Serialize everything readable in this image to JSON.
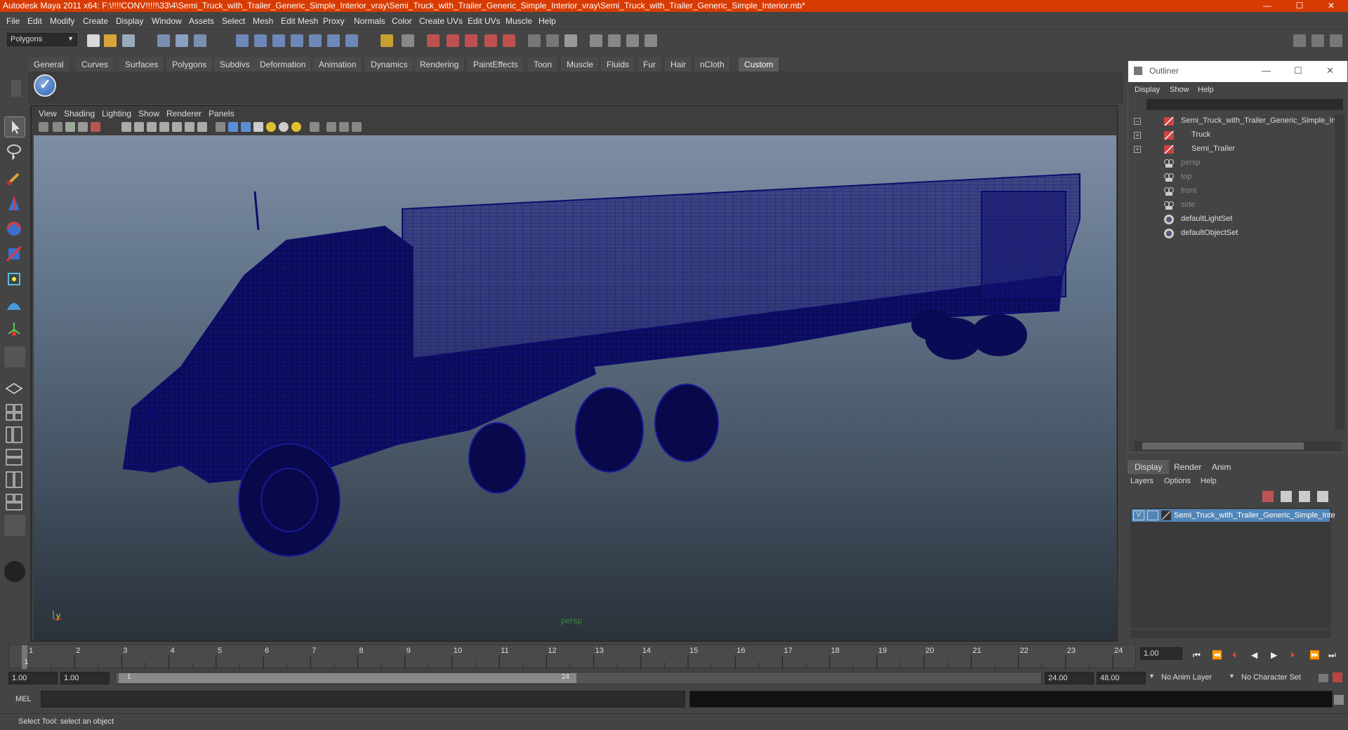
{
  "window": {
    "title": "Autodesk Maya 2011 x64: F:\\!!!!CONV!!!!!\\33\\4\\Semi_Truck_with_Trailer_Generic_Simple_Interior_vray\\Semi_Truck_with_Trailer_Generic_Simple_Interior_vray\\Semi_Truck_with_Trailer_Generic_Simple_Interior.mb*",
    "minimize": "—",
    "maximize": "☐",
    "close": "✕"
  },
  "menubar": [
    "File",
    "Edit",
    "Modify",
    "Create",
    "Display",
    "Window",
    "Assets",
    "Select",
    "Mesh",
    "Edit Mesh",
    "Proxy",
    "Normals",
    "Color",
    "Create UVs",
    "Edit UVs",
    "Muscle",
    "Help"
  ],
  "statusline": {
    "mode": "Polygons"
  },
  "shelf": {
    "tabs": [
      "General",
      "Curves",
      "Surfaces",
      "Polygons",
      "Subdivs",
      "Deformation",
      "Animation",
      "Dynamics",
      "Rendering",
      "PaintEffects",
      "Toon",
      "Muscle",
      "Fluids",
      "Fur",
      "Hair",
      "nCloth",
      "Custom"
    ],
    "active_tab": "Custom"
  },
  "viewport": {
    "menu": [
      "View",
      "Shading",
      "Lighting",
      "Show",
      "Renderer",
      "Panels"
    ],
    "camera_label": "persp",
    "axis_y": "y",
    "axis_x": "x",
    "wire_color": "#0d0d6b"
  },
  "outliner": {
    "title": "Outliner",
    "menu": [
      "Display",
      "Show",
      "Help"
    ],
    "items": [
      {
        "label": "Semi_Truck_with_Trailer_Generic_Simple_Inte",
        "icon": "transform-icon",
        "expand": "−",
        "dim": false
      },
      {
        "label": "Truck",
        "icon": "transform-icon",
        "expand": "+",
        "dim": false
      },
      {
        "label": "Semi_Trailer",
        "icon": "transform-icon",
        "expand": "+",
        "dim": false
      },
      {
        "label": "persp",
        "icon": "camera-icon",
        "expand": "",
        "dim": true
      },
      {
        "label": "top",
        "icon": "camera-icon",
        "expand": "",
        "dim": true
      },
      {
        "label": "front",
        "icon": "camera-icon",
        "expand": "",
        "dim": true
      },
      {
        "label": "side",
        "icon": "camera-icon",
        "expand": "",
        "dim": true
      },
      {
        "label": "defaultLightSet",
        "icon": "set-icon",
        "expand": "",
        "dim": false
      },
      {
        "label": "defaultObjectSet",
        "icon": "set-icon",
        "expand": "",
        "dim": false
      }
    ]
  },
  "layers": {
    "tabs": [
      "Display",
      "Render",
      "Anim"
    ],
    "active_tab": "Display",
    "menu": [
      "Layers",
      "Options",
      "Help"
    ],
    "layer_visible": "V",
    "layer_name": "Semi_Truck_with_Trailer_Generic_Simple_Inte"
  },
  "timeline": {
    "ticks": [
      "1",
      "2",
      "3",
      "4",
      "5",
      "6",
      "7",
      "8",
      "9",
      "10",
      "11",
      "12",
      "13",
      "14",
      "15",
      "16",
      "17",
      "18",
      "19",
      "20",
      "21",
      "22",
      "23",
      "24"
    ],
    "current_frame_marker": "1",
    "current_time": "1.00"
  },
  "range": {
    "start": "1.00",
    "playback_start": "1.00",
    "slider_start": "1",
    "slider_end": "24",
    "playback_end": "24.00",
    "end": "48.00",
    "anim_layer": "No Anim Layer",
    "character_set": "No Character Set"
  },
  "cmd": {
    "label": "MEL"
  },
  "helpline": {
    "text": "Select Tool: select an object"
  }
}
